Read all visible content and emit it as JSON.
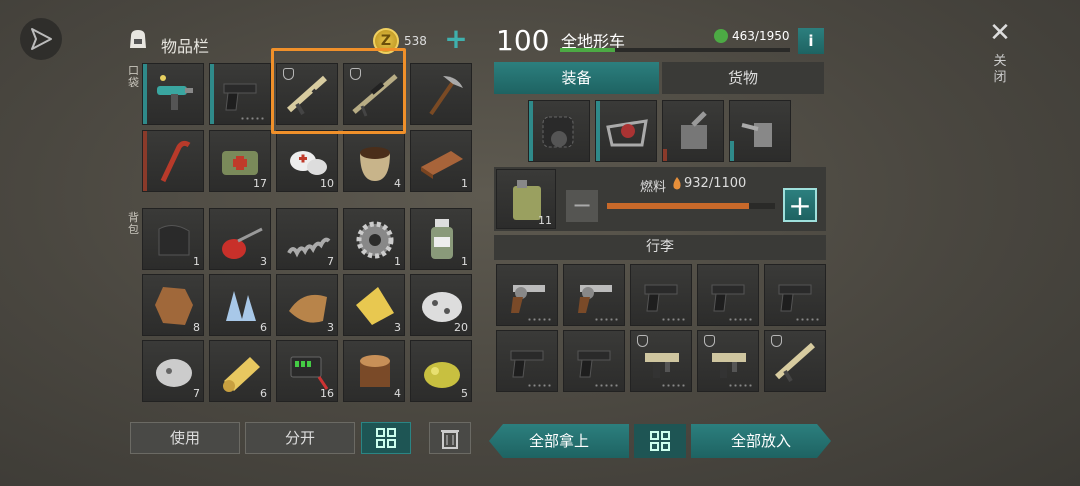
{
  "header": {
    "inventory_title": "物品栏",
    "coins": "538",
    "vehicle_level": "100",
    "vehicle_name": "全地形车",
    "capacity": "463/1950",
    "info_label": "i",
    "close_label": "关闭",
    "close_glyph": "✕"
  },
  "tabs": {
    "equipment": "装备",
    "cargo": "货物"
  },
  "side_labels": {
    "pocket": "口袋",
    "backpack": "背包"
  },
  "pocket_items": [
    {
      "icon": "raygun-icon",
      "count": ""
    },
    {
      "icon": "pistol-icon",
      "count": ""
    },
    {
      "icon": "rifle-icon",
      "count": ""
    },
    {
      "icon": "sniper-rifle-icon",
      "count": ""
    },
    {
      "icon": "pickaxe-icon",
      "count": ""
    },
    {
      "icon": "crowbar-icon",
      "count": ""
    },
    {
      "icon": "medkit-bag-icon",
      "count": "17"
    },
    {
      "icon": "bandage-icon",
      "count": "10"
    },
    {
      "icon": "seed-sack-icon",
      "count": "4"
    },
    {
      "icon": "wood-plank-icon",
      "count": "1"
    }
  ],
  "backpack_items": [
    {
      "icon": "rubber-sheet-icon",
      "count": "1"
    },
    {
      "icon": "oil-can-icon",
      "count": "3"
    },
    {
      "icon": "spring-icon",
      "count": "7"
    },
    {
      "icon": "gear-icon",
      "count": "1"
    },
    {
      "icon": "bottle-icon",
      "count": "1"
    },
    {
      "icon": "animal-hide-icon",
      "count": "8"
    },
    {
      "icon": "crystal-icon",
      "count": "6"
    },
    {
      "icon": "snake-skin-icon",
      "count": "3"
    },
    {
      "icon": "cloth-icon",
      "count": "3"
    },
    {
      "icon": "ore-icon",
      "count": "20"
    },
    {
      "icon": "stone-icon",
      "count": "7"
    },
    {
      "icon": "paper-roll-icon",
      "count": "6"
    },
    {
      "icon": "battery-icon",
      "count": "16"
    },
    {
      "icon": "log-icon",
      "count": "4"
    },
    {
      "icon": "gold-ore-icon",
      "count": "5"
    }
  ],
  "fuel": {
    "label": "燃料",
    "value": "932/1100",
    "level": 0.847,
    "canister_count": "11",
    "minus": "−",
    "plus": "+"
  },
  "luggage_title": "行李",
  "luggage_items": [
    {
      "icon": "revolver-icon",
      "count": ""
    },
    {
      "icon": "revolver-icon",
      "count": ""
    },
    {
      "icon": "pistol-icon",
      "count": ""
    },
    {
      "icon": "pistol-icon",
      "count": ""
    },
    {
      "icon": "pistol-icon",
      "count": ""
    },
    {
      "icon": "pistol-icon",
      "count": ""
    },
    {
      "icon": "pistol-icon",
      "count": ""
    },
    {
      "icon": "smg-icon",
      "count": ""
    },
    {
      "icon": "smg-icon",
      "count": ""
    },
    {
      "icon": "rifle-icon",
      "count": ""
    }
  ],
  "buttons": {
    "use": "使用",
    "split": "分开",
    "take_all": "全部拿上",
    "put_all": "全部放入"
  },
  "colors": {
    "highlight": "#f0902a",
    "accent": "#2a8584",
    "fuel_bar": "#c8692a"
  }
}
